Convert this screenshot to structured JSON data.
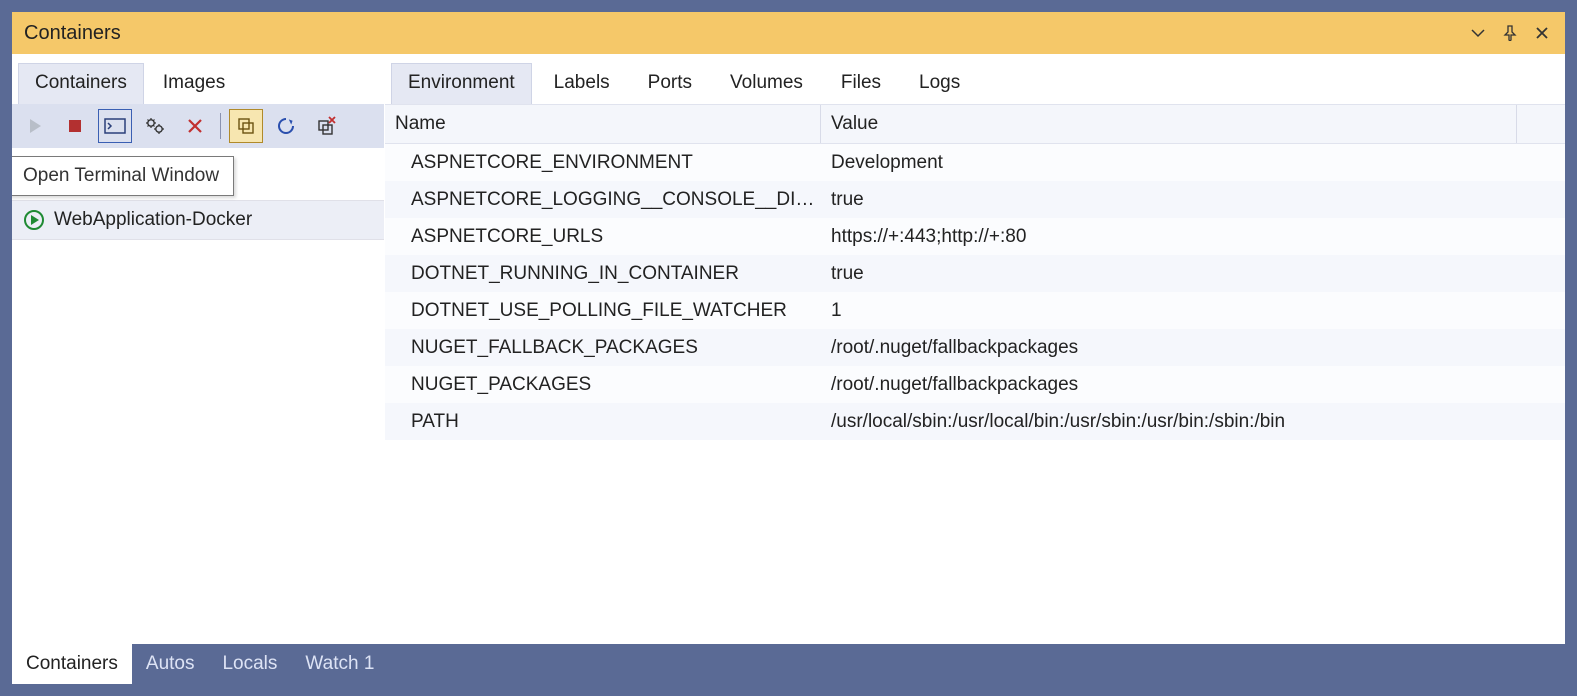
{
  "titlebar": {
    "title": "Containers"
  },
  "leftTabs": [
    {
      "label": "Containers",
      "active": true
    },
    {
      "label": "Images",
      "active": false
    }
  ],
  "tooltip": "Open Terminal Window",
  "containers": [
    {
      "name": "WebApplication-Docker",
      "running": true
    }
  ],
  "detailTabs": [
    {
      "label": "Environment",
      "active": true
    },
    {
      "label": "Labels"
    },
    {
      "label": "Ports"
    },
    {
      "label": "Volumes"
    },
    {
      "label": "Files"
    },
    {
      "label": "Logs"
    }
  ],
  "gridHeaders": {
    "name": "Name",
    "value": "Value"
  },
  "envRows": [
    {
      "name": "ASPNETCORE_ENVIRONMENT",
      "value": "Development"
    },
    {
      "name": "ASPNETCORE_LOGGING__CONSOLE__DISA...",
      "value": "true"
    },
    {
      "name": "ASPNETCORE_URLS",
      "value": "https://+:443;http://+:80"
    },
    {
      "name": "DOTNET_RUNNING_IN_CONTAINER",
      "value": "true"
    },
    {
      "name": "DOTNET_USE_POLLING_FILE_WATCHER",
      "value": "1"
    },
    {
      "name": "NUGET_FALLBACK_PACKAGES",
      "value": "/root/.nuget/fallbackpackages"
    },
    {
      "name": "NUGET_PACKAGES",
      "value": "/root/.nuget/fallbackpackages"
    },
    {
      "name": "PATH",
      "value": "/usr/local/sbin:/usr/local/bin:/usr/sbin:/usr/bin:/sbin:/bin"
    }
  ],
  "bottomTabs": [
    {
      "label": "Containers",
      "active": true
    },
    {
      "label": "Autos"
    },
    {
      "label": "Locals"
    },
    {
      "label": "Watch 1"
    }
  ]
}
